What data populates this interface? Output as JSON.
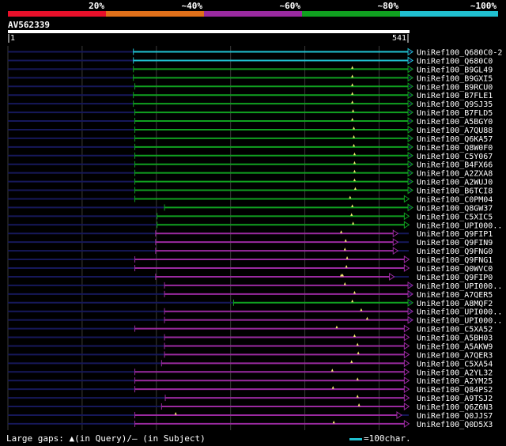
{
  "chart_data": {
    "type": "alignment-overview",
    "query_id": "AV562339",
    "query_start": "1",
    "query_end": "541",
    "query_length": 541,
    "identity_scale": [
      {
        "label": "20%",
        "color": "#e8102a"
      },
      {
        "label": "~40%",
        "color": "#e0701a"
      },
      {
        "label": "~60%",
        "color": "#9a2aa0"
      },
      {
        "label": "~80%",
        "color": "#10a020"
      },
      {
        "label": "~100%",
        "color": "#20c0d0"
      }
    ],
    "hits": [
      {
        "name": "UniRef100_Q680C0-2",
        "start": 170,
        "end": 540,
        "color": "#20c0d0",
        "gaps": []
      },
      {
        "name": "UniRef100_Q680C0",
        "start": 170,
        "end": 540,
        "color": "#20c0d0",
        "gaps": []
      },
      {
        "name": "UniRef100_B9GL49",
        "start": 170,
        "end": 540,
        "color": "#10a020",
        "gaps": [
          465
        ]
      },
      {
        "name": "UniRef100_B9GXI5",
        "start": 170,
        "end": 540,
        "color": "#10a020",
        "gaps": [
          465
        ]
      },
      {
        "name": "UniRef100_B9RCU0",
        "start": 172,
        "end": 540,
        "color": "#10a020",
        "gaps": [
          465
        ]
      },
      {
        "name": "UniRef100_B7FLE1",
        "start": 170,
        "end": 540,
        "color": "#10a020",
        "gaps": [
          465
        ]
      },
      {
        "name": "UniRef100_Q9SJ35",
        "start": 170,
        "end": 540,
        "color": "#10a020",
        "gaps": [
          465
        ]
      },
      {
        "name": "UniRef100_B7FLD5",
        "start": 172,
        "end": 540,
        "color": "#10a020",
        "gaps": [
          466
        ]
      },
      {
        "name": "UniRef100_A5BGY0",
        "start": 172,
        "end": 540,
        "color": "#10a020",
        "gaps": [
          465
        ]
      },
      {
        "name": "UniRef100_A7QU88",
        "start": 172,
        "end": 540,
        "color": "#10a020",
        "gaps": [
          467
        ]
      },
      {
        "name": "UniRef100_Q6KA57",
        "start": 172,
        "end": 540,
        "color": "#10a020",
        "gaps": [
          467
        ]
      },
      {
        "name": "UniRef100_Q8W0F0",
        "start": 172,
        "end": 540,
        "color": "#10a020",
        "gaps": [
          467
        ]
      },
      {
        "name": "UniRef100_C5Y067",
        "start": 172,
        "end": 540,
        "color": "#10a020",
        "gaps": [
          468
        ]
      },
      {
        "name": "UniRef100_B4FX66",
        "start": 172,
        "end": 540,
        "color": "#10a020",
        "gaps": [
          468
        ]
      },
      {
        "name": "UniRef100_A2ZXA8",
        "start": 172,
        "end": 540,
        "color": "#10a020",
        "gaps": [
          468
        ]
      },
      {
        "name": "UniRef100_A2WUJ0",
        "start": 172,
        "end": 540,
        "color": "#10a020",
        "gaps": [
          468
        ]
      },
      {
        "name": "UniRef100_B6TCI8",
        "start": 172,
        "end": 540,
        "color": "#10a020",
        "gaps": [
          469
        ]
      },
      {
        "name": "UniRef100_C0PM04",
        "start": 172,
        "end": 535,
        "color": "#10a020",
        "gaps": [
          462
        ]
      },
      {
        "name": "UniRef100_Q8GW37",
        "start": 212,
        "end": 540,
        "color": "#10a020",
        "gaps": [
          465
        ]
      },
      {
        "name": "UniRef100_C5XIC5",
        "start": 202,
        "end": 535,
        "color": "#10a020",
        "gaps": [
          464
        ]
      },
      {
        "name": "UniRef100_UPI000..",
        "start": 202,
        "end": 535,
        "color": "#10a020",
        "gaps": [
          466
        ]
      },
      {
        "name": "UniRef100_Q9FIP1",
        "start": 200,
        "end": 520,
        "color": "#9a2aa0",
        "gaps": [
          450
        ]
      },
      {
        "name": "UniRef100_Q9FIN9",
        "start": 200,
        "end": 520,
        "color": "#9a2aa0",
        "gaps": [
          456
        ]
      },
      {
        "name": "UniRef100_Q9FNG0",
        "start": 200,
        "end": 520,
        "color": "#9a2aa0",
        "gaps": [
          455
        ]
      },
      {
        "name": "UniRef100_Q9FNG1",
        "start": 172,
        "end": 535,
        "color": "#9a2aa0",
        "gaps": [
          458
        ]
      },
      {
        "name": "UniRef100_Q0WVC0",
        "start": 172,
        "end": 535,
        "color": "#9a2aa0",
        "gaps": [
          457
        ]
      },
      {
        "name": "UniRef100_Q9FIP0",
        "start": 200,
        "end": 515,
        "color": "#9a2aa0",
        "gaps": [
          450,
          452
        ]
      },
      {
        "name": "UniRef100_UPI000..",
        "start": 212,
        "end": 540,
        "color": "#9a2aa0",
        "gaps": [
          455
        ]
      },
      {
        "name": "UniRef100_A7QER5",
        "start": 212,
        "end": 540,
        "color": "#9a2aa0",
        "gaps": [
          468
        ]
      },
      {
        "name": "UniRef100_A8MQF2",
        "start": 305,
        "end": 540,
        "color": "#10a020",
        "gaps": [
          465
        ]
      },
      {
        "name": "UniRef100_UPI000..",
        "start": 212,
        "end": 540,
        "color": "#9a2aa0",
        "gaps": [
          477
        ]
      },
      {
        "name": "UniRef100_UPI000..",
        "start": 212,
        "end": 540,
        "color": "#9a2aa0",
        "gaps": [
          485
        ]
      },
      {
        "name": "UniRef100_C5XA52",
        "start": 172,
        "end": 535,
        "color": "#9a2aa0",
        "gaps": [
          444
        ]
      },
      {
        "name": "UniRef100_A5BH03",
        "start": 212,
        "end": 535,
        "color": "#9a2aa0",
        "gaps": [
          468
        ]
      },
      {
        "name": "UniRef100_A5AKW9",
        "start": 212,
        "end": 535,
        "color": "#9a2aa0",
        "gaps": [
          472
        ]
      },
      {
        "name": "UniRef100_A7QER3",
        "start": 212,
        "end": 535,
        "color": "#9a2aa0",
        "gaps": [
          473
        ]
      },
      {
        "name": "UniRef100_C5XA54",
        "start": 208,
        "end": 535,
        "color": "#9a2aa0",
        "gaps": [
          464
        ]
      },
      {
        "name": "UniRef100_A2YL32",
        "start": 172,
        "end": 535,
        "color": "#9a2aa0",
        "gaps": [
          438
        ]
      },
      {
        "name": "UniRef100_A2YM25",
        "start": 172,
        "end": 535,
        "color": "#9a2aa0",
        "gaps": [
          472
        ]
      },
      {
        "name": "UniRef100_Q84PS2",
        "start": 172,
        "end": 535,
        "color": "#9a2aa0",
        "gaps": [
          439
        ]
      },
      {
        "name": "UniRef100_A9TSJ2",
        "start": 213,
        "end": 535,
        "color": "#9a2aa0",
        "gaps": [
          472
        ]
      },
      {
        "name": "UniRef100_Q6Z6N3",
        "start": 208,
        "end": 535,
        "color": "#9a2aa0",
        "gaps": [
          474
        ]
      },
      {
        "name": "UniRef100_Q0JJS7",
        "start": 172,
        "end": 525,
        "color": "#9a2aa0",
        "gaps": [
          227
        ]
      },
      {
        "name": "UniRef100_Q0D5X3",
        "start": 172,
        "end": 535,
        "color": "#9a2aa0",
        "gaps": [
          440
        ]
      }
    ]
  },
  "footer": {
    "gaps_prefix": "Large gaps: ",
    "gaps_query_marker": "▲",
    "gaps_query_text": "(in Query)/",
    "gaps_subject_marker": "–",
    "gaps_subject_text": " (in Subject)",
    "scale_text": "=100char."
  }
}
